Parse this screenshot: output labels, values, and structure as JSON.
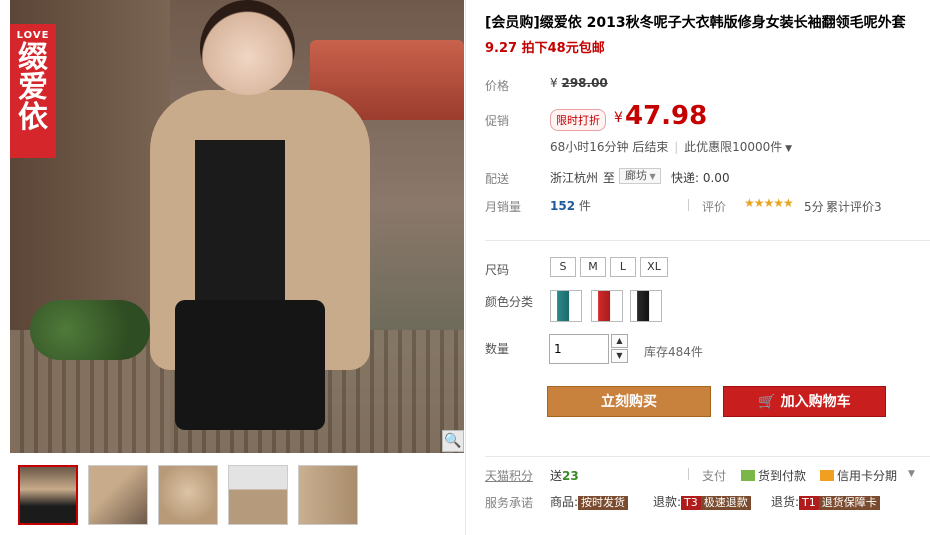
{
  "brand_tag": {
    "en": "LOVE",
    "zh": "缀爱依"
  },
  "product": {
    "title": "[会员购]缀爱依 2013秋冬呢子大衣韩版修身女装长袖翻领毛呢外套",
    "subtitle": "9.27 拍下48元包邮"
  },
  "price": {
    "label": "价格",
    "original": "298.00",
    "currency": "¥",
    "promo_label": "促销",
    "promo_badge": "限时打折",
    "promo_price": "47.98",
    "timer": "68小时16分钟 后结束",
    "limit": "此优惠限10000件"
  },
  "shipping": {
    "label": "配送",
    "from": "浙江杭州",
    "to_word": "至",
    "dest": "廊坊",
    "express": "快递: 0.00"
  },
  "sales": {
    "label": "月销量",
    "count": "152",
    "unit": "件",
    "rating_label": "评价",
    "stars": "★★★★★",
    "score": "5分",
    "review_count": "累计评价3"
  },
  "size": {
    "label": "尺码",
    "options": [
      "S",
      "M",
      "L",
      "XL"
    ]
  },
  "color": {
    "label": "颜色分类",
    "options": [
      "teal",
      "red",
      "black"
    ]
  },
  "quantity": {
    "label": "数量",
    "value": "1",
    "stock": "库存484件"
  },
  "actions": {
    "buy": "立刻购买",
    "cart": "加入购物车"
  },
  "points": {
    "label": "天猫积分",
    "send_prefix": "送",
    "send_value": "23",
    "pay_label": "支付",
    "pay_cod": "货到付款",
    "pay_credit": "信用卡分期"
  },
  "promise": {
    "label": "服务承诺",
    "goods_prefix": "商品:",
    "goods_tag": "按时发货",
    "refund_prefix": "退款:",
    "refund_code": "T3",
    "refund_tag": "极速退款",
    "return_prefix": "退货:",
    "return_code": "T1",
    "return_tag": "退货保障卡"
  },
  "colors": {
    "accent": "#c40000",
    "buy": "#c9813e",
    "cart": "#c81e1e"
  }
}
